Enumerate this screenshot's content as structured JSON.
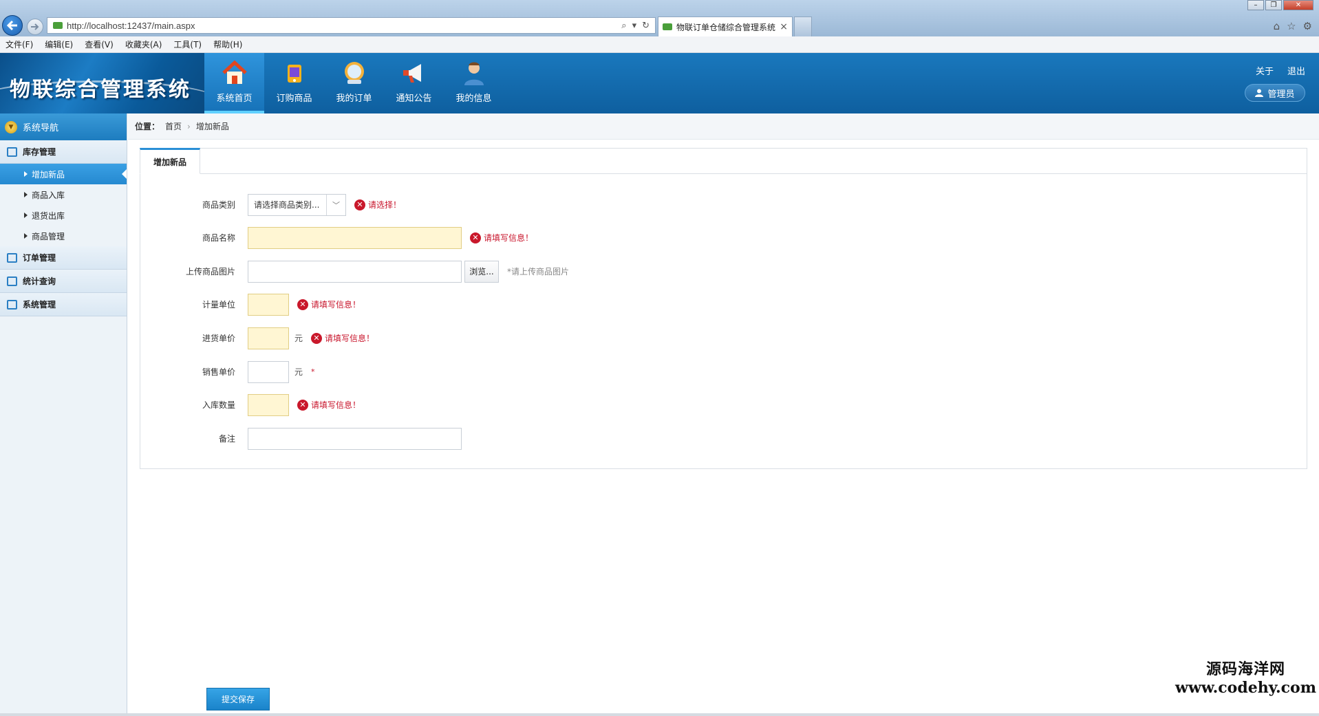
{
  "browser": {
    "url": "http://localhost:12437/main.aspx",
    "tab_title": "物联订单仓储综合管理系统",
    "tab_close": "×"
  },
  "menubar": [
    "文件(F)",
    "编辑(E)",
    "查看(V)",
    "收藏夹(A)",
    "工具(T)",
    "帮助(H)"
  ],
  "app": {
    "logo": "物联综合管理系统",
    "nav": [
      {
        "label": "系统首页",
        "icon": "home-icon",
        "active": true
      },
      {
        "label": "订购商品",
        "icon": "shopping-icon",
        "active": false
      },
      {
        "label": "我的订单",
        "icon": "order-icon",
        "active": false
      },
      {
        "label": "通知公告",
        "icon": "megaphone-icon",
        "active": false
      },
      {
        "label": "我的信息",
        "icon": "user-icon",
        "active": false
      }
    ],
    "about": "关于",
    "logout": "退出",
    "user": "管理员"
  },
  "sidebar": {
    "title": "系统导航",
    "groups": [
      {
        "label": "库存管理",
        "items": [
          "增加新品",
          "商品入库",
          "退货出库",
          "商品管理"
        ]
      },
      {
        "label": "订单管理"
      },
      {
        "label": "统计查询"
      },
      {
        "label": "系统管理"
      }
    ]
  },
  "breadcrumb": {
    "label": "位置：",
    "home": "首页",
    "sep": "›",
    "current": "增加新品"
  },
  "form": {
    "tab": "增加新品",
    "category": {
      "label": "商品类别",
      "value": "请选择商品类别...",
      "error": "请选择！"
    },
    "name": {
      "label": "商品名称",
      "value": "",
      "error": "请填写信息！"
    },
    "image": {
      "label": "上传商品图片",
      "browse": "浏览...",
      "hint": "*请上传商品图片"
    },
    "unit": {
      "label": "计量单位",
      "error": "请填写信息！"
    },
    "purchase_price": {
      "label": "进货单价",
      "unit": "元",
      "error": "请填写信息！"
    },
    "sale_price": {
      "label": "销售单价",
      "unit": "元",
      "required": "*"
    },
    "quantity": {
      "label": "入库数量",
      "error": "请填写信息！"
    },
    "remark": {
      "label": "备注"
    },
    "submit": "提交保存"
  },
  "watermark": {
    "line1": "源码海洋网",
    "line2": "www.codehy.com"
  }
}
